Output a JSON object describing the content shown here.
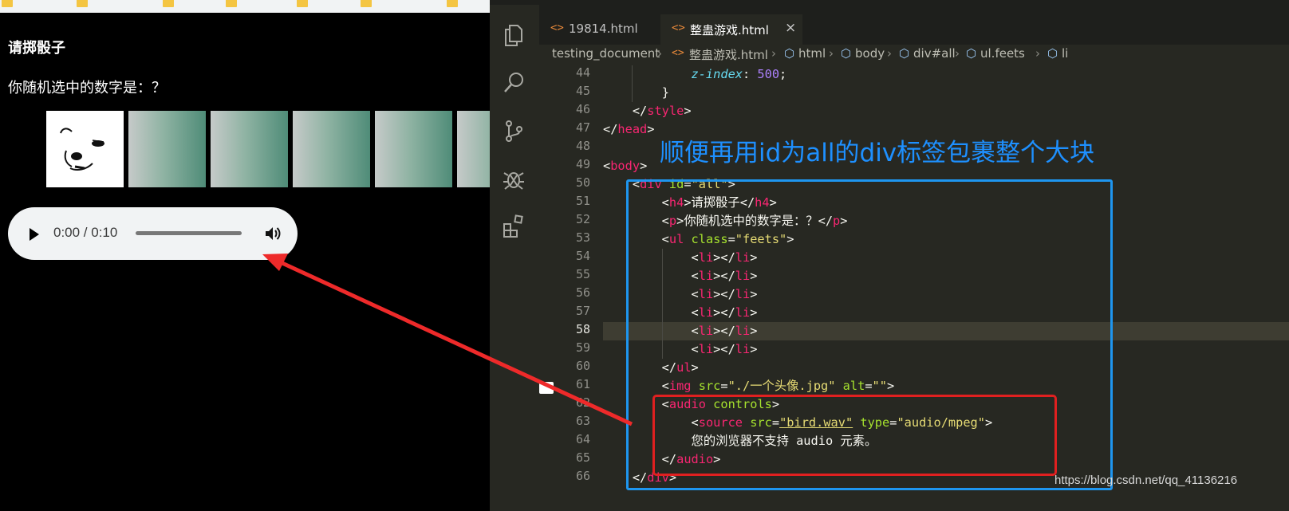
{
  "browser": {
    "heading": "请掷骰子",
    "paragraph": "你随机选中的数字是：？",
    "audio": {
      "time": "0:00 / 0:10"
    }
  },
  "editor": {
    "tabs": [
      {
        "label": "19814.html",
        "active": false
      },
      {
        "label": "整蛊游戏.html",
        "active": true,
        "close": "×"
      }
    ],
    "breadcrumb": [
      "testing_document",
      "整蛊游戏.html",
      "html",
      "body",
      "div#all",
      "ul.feets",
      "li"
    ],
    "line_numbers": [
      44,
      45,
      46,
      47,
      48,
      49,
      50,
      51,
      52,
      53,
      54,
      55,
      56,
      57,
      58,
      59,
      60,
      61,
      62,
      63,
      64,
      65,
      66
    ],
    "current_line": 58,
    "code": {
      "l44_prop": "z-index",
      "l44_colon": ": ",
      "l44_val": "500",
      "l44_semi": ";",
      "l45": "}",
      "l46_open": "</",
      "l46_tag": "style",
      "l46_close": ">",
      "l47_open": "</",
      "l47_tag": "head",
      "l47_close": ">",
      "l49_open": "<",
      "l49_tag": "body",
      "l49_close": ">",
      "l50_open": "<",
      "l50_tag": "div",
      "l50_attr": " id",
      "l50_eq": "=",
      "l50_str": "\"all\"",
      "l50_close": ">",
      "l51_tag": "h4",
      "l51_text": "请掷骰子",
      "l52_tag": "p",
      "l52_text": "你随机选中的数字是：？",
      "l53_tag": "ul",
      "l53_attr": " class",
      "l53_str": "\"feets\"",
      "li_tag": "li",
      "l60_tag": "ul",
      "l61_tag": "img",
      "l61_attr1": " src",
      "l61_str1": "\"./一个头像.jpg\"",
      "l61_attr2": " alt",
      "l61_str2": "\"\"",
      "l62_tag": "audio",
      "l62_attr": " controls",
      "l63_tag": "source",
      "l63_attr1": " src",
      "l63_str1": "\"bird.wav\"",
      "l63_attr2": " type",
      "l63_str2": "\"audio/mpeg\"",
      "l64_text": "您的浏览器不支持 audio 元素。",
      "l65_tag": "audio",
      "l66_tag": "div"
    }
  },
  "annotation": "顺便再用id为all的div标签包裹整个大块",
  "watermark": "https://blog.csdn.net/qq_41136216",
  "colors": {
    "annotation_blue": "#1e90ff",
    "highlight_red": "#e02020",
    "arrow_red": "#ee2a2a"
  }
}
